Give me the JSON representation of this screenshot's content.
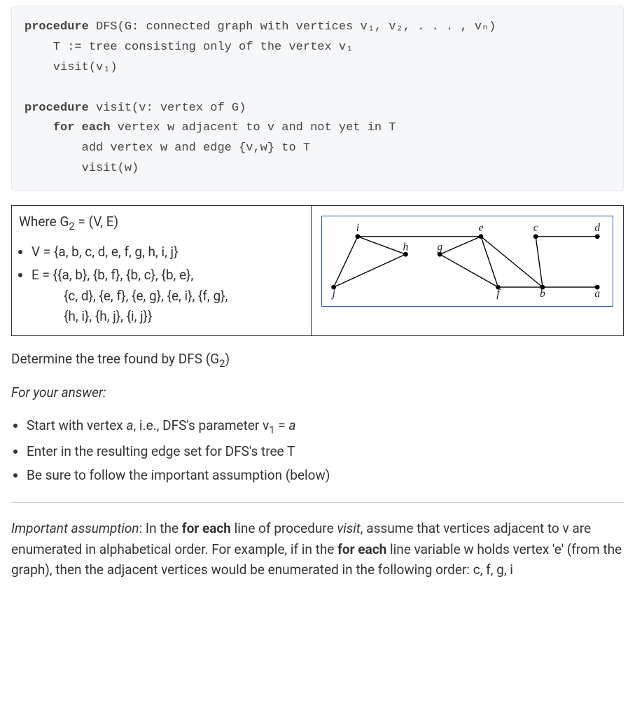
{
  "procedure_code": {
    "l1_kw": "procedure",
    "l1_rest": " DFS(G: connected graph with vertices v₁, v₂, . . . , vₙ)",
    "l2": "    T := tree consisting only of the vertex v₁",
    "l3": "    visit(v₁)",
    "l4": "",
    "l5_kw": "procedure",
    "l5_rest": " visit(v: vertex of G)",
    "l6_pre": "    ",
    "l6_kw": "for each",
    "l6_rest": " vertex w adjacent to v and not yet in T",
    "l7": "        add vertex w and edge {v,w} to T",
    "l8": "        visit(w)"
  },
  "graph_def": {
    "heading_prefix": "Where G",
    "heading_sub": "2",
    "heading_suffix": " = (V, E)",
    "v_line": "V = {a, b, c, d, e, f, g, h, i, j}",
    "e_line1": "E = {{a, b}, {b, f}, {b, c}, {b, e},",
    "e_line2": "{c, d}, {e, f}, {e, g}, {e, i}, {f, g},",
    "e_line3": "{h, i}, {h, j}, {i, j}}"
  },
  "graph_labels": {
    "a": "a",
    "b": "b",
    "c": "c",
    "d": "d",
    "e": "e",
    "f": "f",
    "g": "g",
    "h": "h",
    "i": "i",
    "j": "j"
  },
  "question": {
    "prefix": "Determine the tree found by DFS (G",
    "sub": "2",
    "suffix": ")"
  },
  "answer_header": "For your answer:",
  "instructions": {
    "i1_pre": "Start with vertex ",
    "i1_italic": "a",
    "i1_mid": ", i.e., DFS's parameter v",
    "i1_sub": "1",
    "i1_post": " = ",
    "i1_post2": "a",
    "i2": "Enter in the resulting edge set for DFS's tree T",
    "i3": "Be sure to follow the important assumption (below)"
  },
  "assumption": {
    "lead_italic": "Important assumption",
    "seg1": ": In the ",
    "bold1": "for each",
    "seg2": " line of procedure ",
    "italic_visit": "visit",
    "seg3": ", assume that vertices adjacent to v are enumerated in alphabetical order. For example, if in the ",
    "bold2": "for each",
    "seg4": " line variable w holds vertex 'e' (from the graph), then the adjacent vertices would be enumerated in the following order: c, f, g, i"
  }
}
